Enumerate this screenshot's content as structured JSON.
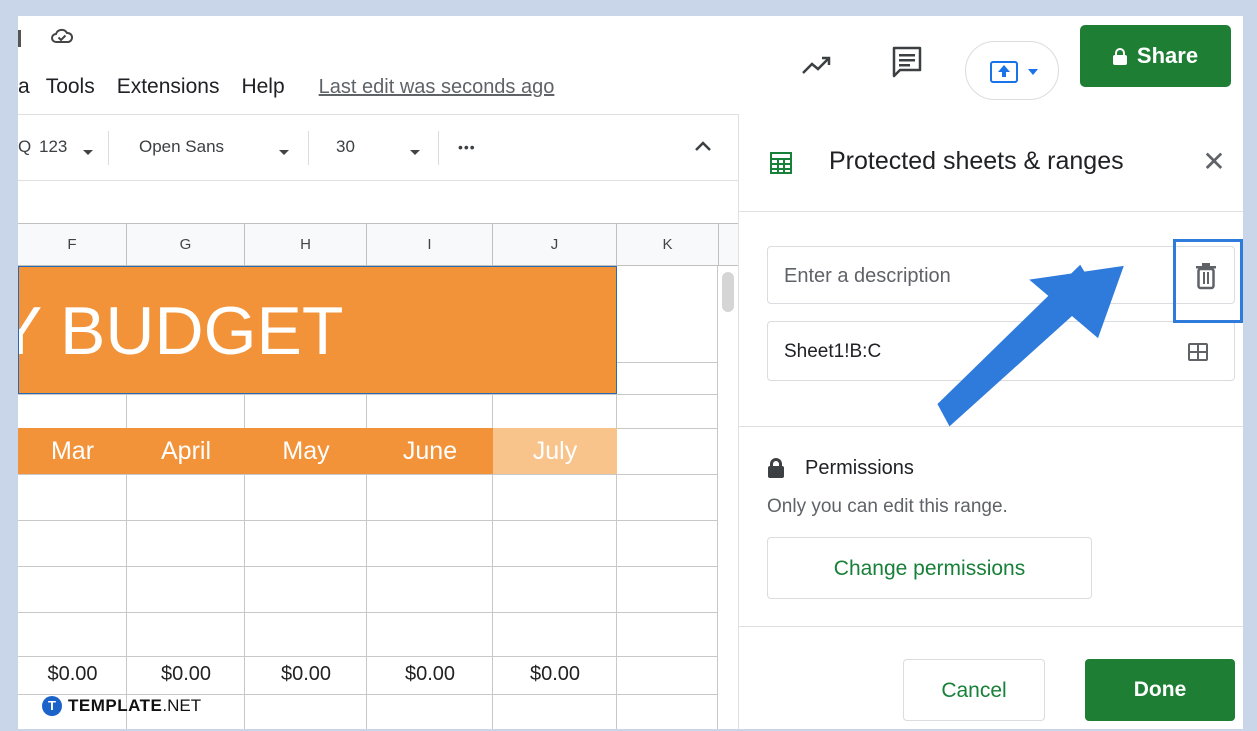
{
  "menu": {
    "cut_item": "a",
    "items": [
      "Tools",
      "Extensions",
      "Help"
    ],
    "last_edit": "Last edit was seconds ago"
  },
  "header": {
    "share_label": "Share"
  },
  "toolbar": {
    "cut_icon": "Q",
    "format_label": "123",
    "font": "Open Sans",
    "font_size": "30",
    "more": "•••"
  },
  "columns": [
    "F",
    "G",
    "H",
    "I",
    "J",
    "K"
  ],
  "sheet": {
    "banner": "Y BUDGET",
    "months": [
      "Mar",
      "April",
      "May",
      "June",
      "July"
    ],
    "totals": [
      "$0.00",
      "$0.00",
      "$0.00",
      "$0.00",
      "$0.00"
    ]
  },
  "panel": {
    "title": "Protected sheets & ranges",
    "description_placeholder": "Enter a description",
    "range_value": "Sheet1!B:C",
    "permissions_title": "Permissions",
    "permissions_subtitle": "Only you can edit this range.",
    "change_permissions": "Change permissions",
    "cancel": "Cancel",
    "done": "Done"
  },
  "watermark": {
    "brand": "TEMPLATE",
    "suffix": ".NET"
  },
  "colors": {
    "accent_green": "#1e7e34",
    "banner_orange": "#f2933a",
    "highlight_blue": "#2f7bdc"
  }
}
